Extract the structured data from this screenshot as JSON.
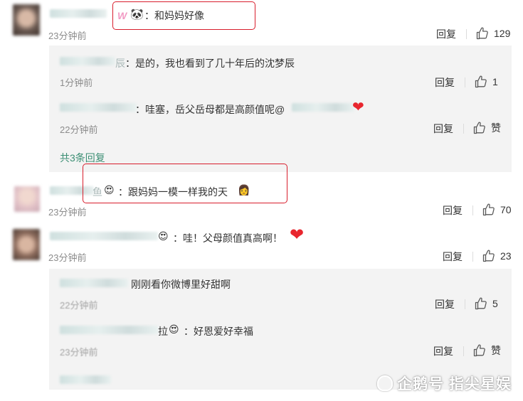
{
  "comments": [
    {
      "text": "：和妈妈好像",
      "time": "23分钟前",
      "reply_label": "回复",
      "likes": "129",
      "badge_w": "W",
      "badge_panda": "🐼",
      "replies": [
        {
          "name_suffix": "辰",
          "text": "：是的，我也看到了几十年后的沈梦辰",
          "time": "1分钟前",
          "reply_label": "回复",
          "likes": "1"
        },
        {
          "text": "：哇塞，岳父岳母都是高颜值呢@",
          "time": "22分钟前",
          "reply_label": "回复",
          "likes": "赞",
          "heart": "❤"
        }
      ],
      "more_replies": "共3条回复"
    },
    {
      "name_suffix": "鱼",
      "badge": "😍",
      "text": "：跟妈妈一模一样我的天",
      "end_emoji": "👩",
      "time": "23分钟前",
      "reply_label": "回复",
      "likes": "70"
    },
    {
      "badge": "😍",
      "text": "：哇！父母颜值真高啊！",
      "heart": "❤",
      "time": "23分钟前",
      "reply_label": "回复",
      "likes": "23",
      "replies": [
        {
          "text": "刚刚看你微博里好甜啊",
          "time": "22分钟前",
          "reply_label": "回复",
          "likes": "5"
        },
        {
          "name_suffix": "拉",
          "badge": "😍",
          "text": "：好恩爱好幸福",
          "time": "23分钟前",
          "reply_label": "回复",
          "likes": "赞"
        }
      ]
    }
  ],
  "watermark": "企鹅号 指尖星娱",
  "colors": {
    "accent_link": "#3c8f74",
    "highlight_box": "#d81e2c",
    "heart": "#e8262e"
  },
  "icons": {
    "like": "thumbs-up-icon",
    "watermark": "penguin-icon"
  }
}
